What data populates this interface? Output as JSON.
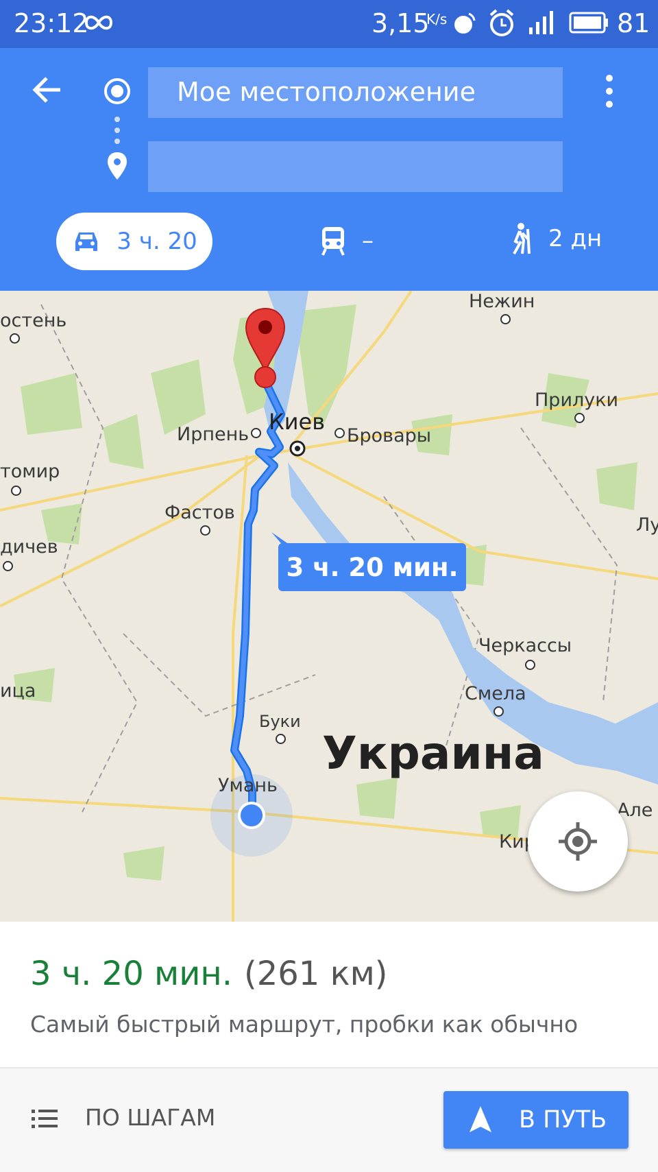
{
  "status_bar": {
    "time": "23:12",
    "net_speed": "3,15",
    "net_unit": "K/s",
    "battery": "81",
    "icons": [
      "infinity-icon",
      "satellite-icon",
      "alarm-icon",
      "signal-icon",
      "battery-icon"
    ]
  },
  "header": {
    "origin": "Мое местоположение",
    "destination": "",
    "modes": [
      {
        "icon": "car-icon",
        "label": "3 ч. 20",
        "selected": true
      },
      {
        "icon": "train-icon",
        "label": "–"
      },
      {
        "icon": "walk-icon",
        "label": "2 дн"
      }
    ]
  },
  "map": {
    "route_bubble": "3 ч. 20 мин.",
    "country": "Украина",
    "cities": [
      "Нежин",
      "остень",
      "Прилуки",
      "Киев",
      "Ирпень",
      "Бровары",
      "томир",
      "Фастов",
      "Лу",
      "дичев",
      "Черкассы",
      "Смела",
      "ица",
      "Буки",
      "Умань",
      "Але",
      "Кировоград"
    ]
  },
  "summary": {
    "duration": "3 ч. 20 мин.",
    "distance": "(261 км)",
    "description": "Самый быстрый маршрут, пробки как обычно"
  },
  "bottom": {
    "steps": "ПО ШАГАМ",
    "start": "В ПУТЬ"
  },
  "colors": {
    "header": "#4285f4",
    "status": "#3367d6",
    "route": "#4285f4",
    "duration_green": "#188038",
    "pin": "#e53935"
  }
}
